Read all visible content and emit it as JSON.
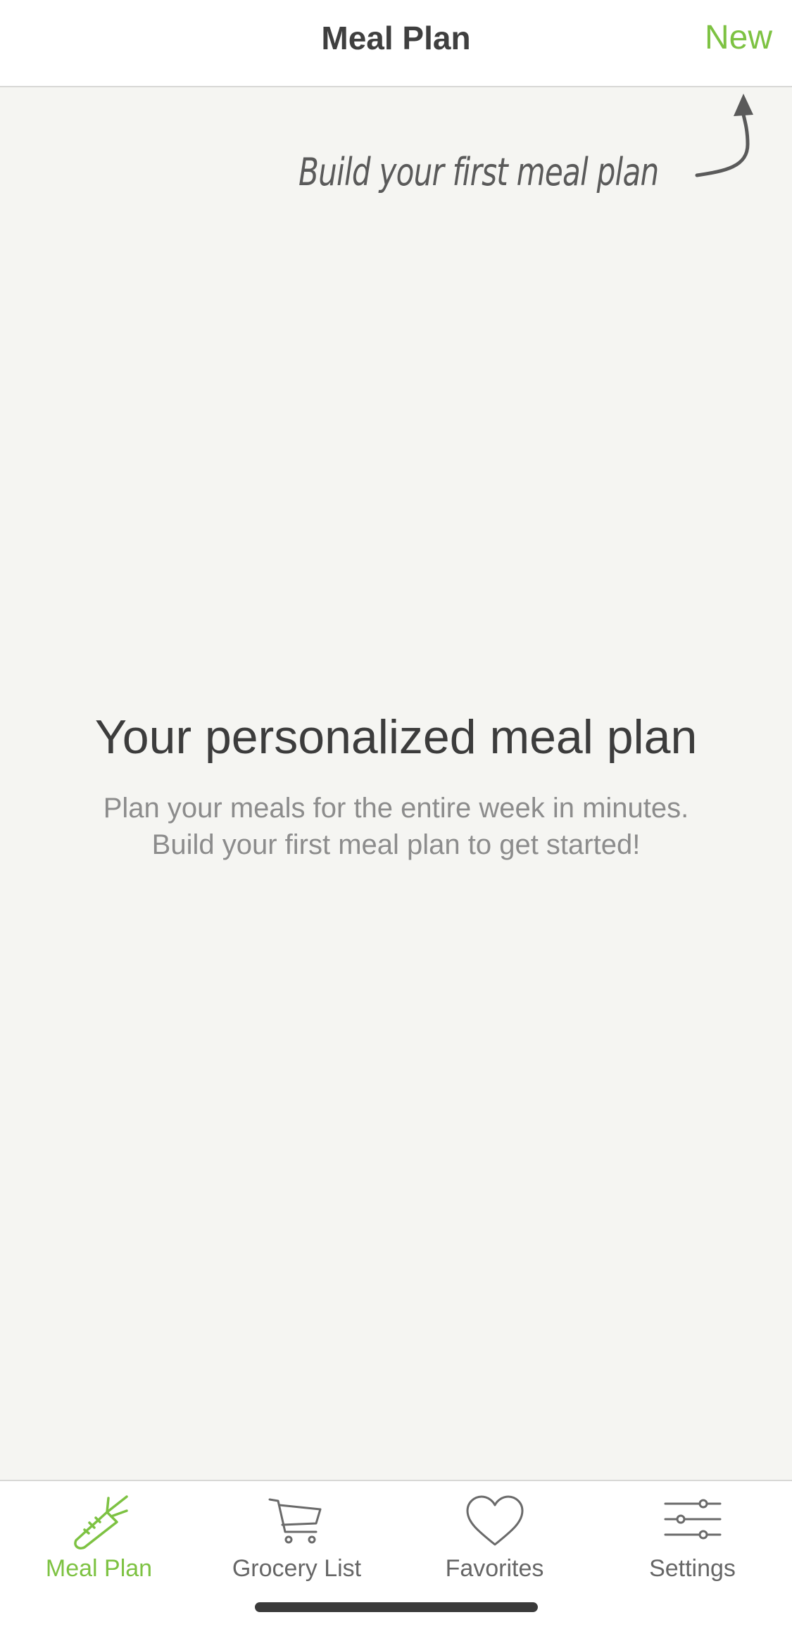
{
  "navbar": {
    "title": "Meal Plan",
    "new_label": "New"
  },
  "hint": {
    "text": "Build your first meal plan"
  },
  "empty_state": {
    "title": "Your personalized meal plan",
    "subtitle_line1": "Plan your meals for the entire week in minutes.",
    "subtitle_line2": "Build your first meal plan to get started!"
  },
  "tabs": [
    {
      "label": "Meal Plan",
      "icon": "carrot-icon",
      "active": true
    },
    {
      "label": "Grocery List",
      "icon": "cart-icon",
      "active": false
    },
    {
      "label": "Favorites",
      "icon": "heart-icon",
      "active": false
    },
    {
      "label": "Settings",
      "icon": "sliders-icon",
      "active": false
    }
  ],
  "colors": {
    "accent": "#7dc242",
    "background": "#f5f5f2",
    "text": "#3c3c3c",
    "muted": "#8c8c8c"
  }
}
